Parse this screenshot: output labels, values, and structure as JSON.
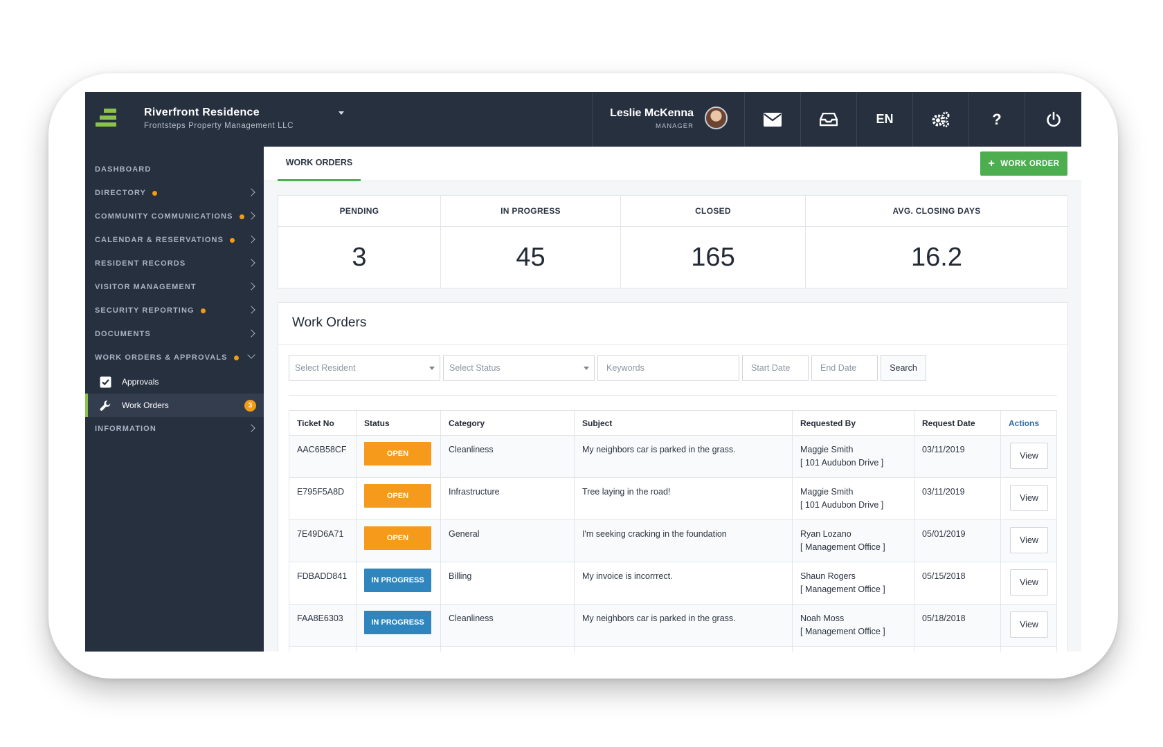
{
  "header": {
    "brand_name": "Riverfront Residence",
    "brand_sub": "Frontsteps Property Management LLC",
    "user_name": "Leslie McKenna",
    "user_role": "MANAGER",
    "language": "EN",
    "icons": [
      "envelope-icon",
      "inbox-icon",
      "gears-icon",
      "help-icon",
      "power-icon"
    ]
  },
  "sidebar": {
    "items": [
      {
        "label": "DASHBOARD",
        "dot": false,
        "chevron": false
      },
      {
        "label": "DIRECTORY",
        "dot": true,
        "chevron": true
      },
      {
        "label": "COMMUNITY COMMUNICATIONS",
        "dot": true,
        "chevron": true
      },
      {
        "label": "CALENDAR & RESERVATIONS",
        "dot": true,
        "chevron": true
      },
      {
        "label": "RESIDENT RECORDS",
        "dot": false,
        "chevron": true
      },
      {
        "label": "VISITOR MANAGEMENT",
        "dot": false,
        "chevron": true
      },
      {
        "label": "SECURITY REPORTING",
        "dot": true,
        "chevron": true
      },
      {
        "label": "DOCUMENTS",
        "dot": false,
        "chevron": true
      },
      {
        "label": "WORK ORDERS & APPROVALS",
        "dot": true,
        "chevron": "down"
      }
    ],
    "sub_items": [
      {
        "label": "Approvals",
        "icon": "checkbox-icon"
      },
      {
        "label": "Work Orders",
        "icon": "wrench-icon",
        "badge": "3"
      }
    ],
    "info_label": "INFORMATION"
  },
  "main": {
    "tab_label": "WORK ORDERS",
    "add_button": "WORK ORDER",
    "stats": [
      {
        "label": "PENDING",
        "value": "3"
      },
      {
        "label": "IN PROGRESS",
        "value": "45"
      },
      {
        "label": "CLOSED",
        "value": "165"
      },
      {
        "label": "AVG. CLOSING DAYS",
        "value": "16.2"
      }
    ],
    "panel_title": "Work Orders",
    "filters": {
      "resident": "Select Resident",
      "status": "Select Status",
      "keywords": "Keywords",
      "start_date": "Start Date",
      "end_date": "End Date",
      "search": "Search"
    },
    "table": {
      "columns": [
        "Ticket No",
        "Status",
        "Category",
        "Subject",
        "Requested By",
        "Request Date",
        "Actions"
      ],
      "rows": [
        {
          "ticket": "AAC6B58CF",
          "status": "OPEN",
          "category": "Cleanliness",
          "subject": "My neighbors car is parked in the grass.",
          "requester": "Maggie Smith",
          "location": "[ 101 Audubon Drive ]",
          "date": "03/11/2019",
          "action": "View"
        },
        {
          "ticket": "E795F5A8D",
          "status": "OPEN",
          "category": "Infrastructure",
          "subject": "Tree laying in the road!",
          "requester": "Maggie Smith",
          "location": "[ 101 Audubon Drive ]",
          "date": "03/11/2019",
          "action": "View"
        },
        {
          "ticket": "7E49D6A71",
          "status": "OPEN",
          "category": "General",
          "subject": "I'm seeking cracking in the foundation",
          "requester": "Ryan Lozano",
          "location": "[ Management Office ]",
          "date": "05/01/2019",
          "action": "View"
        },
        {
          "ticket": "FDBADD841",
          "status": "IN PROGRESS",
          "category": "Billing",
          "subject": "My invoice is incorrrect.",
          "requester": "Shaun Rogers",
          "location": "[ Management Office ]",
          "date": "05/15/2018",
          "action": "View"
        },
        {
          "ticket": "FAA8E6303",
          "status": "IN PROGRESS",
          "category": "Cleanliness",
          "subject": "My neighbors car is parked in the grass.",
          "requester": "Noah Moss",
          "location": "[ Management Office ]",
          "date": "05/18/2018",
          "action": "View"
        }
      ]
    }
  },
  "colors": {
    "nav_bg": "#27303f",
    "accent_green": "#4cae4f",
    "open": "#f59a1a",
    "in_progress": "#2f86bf",
    "dot": "#f39c12"
  }
}
